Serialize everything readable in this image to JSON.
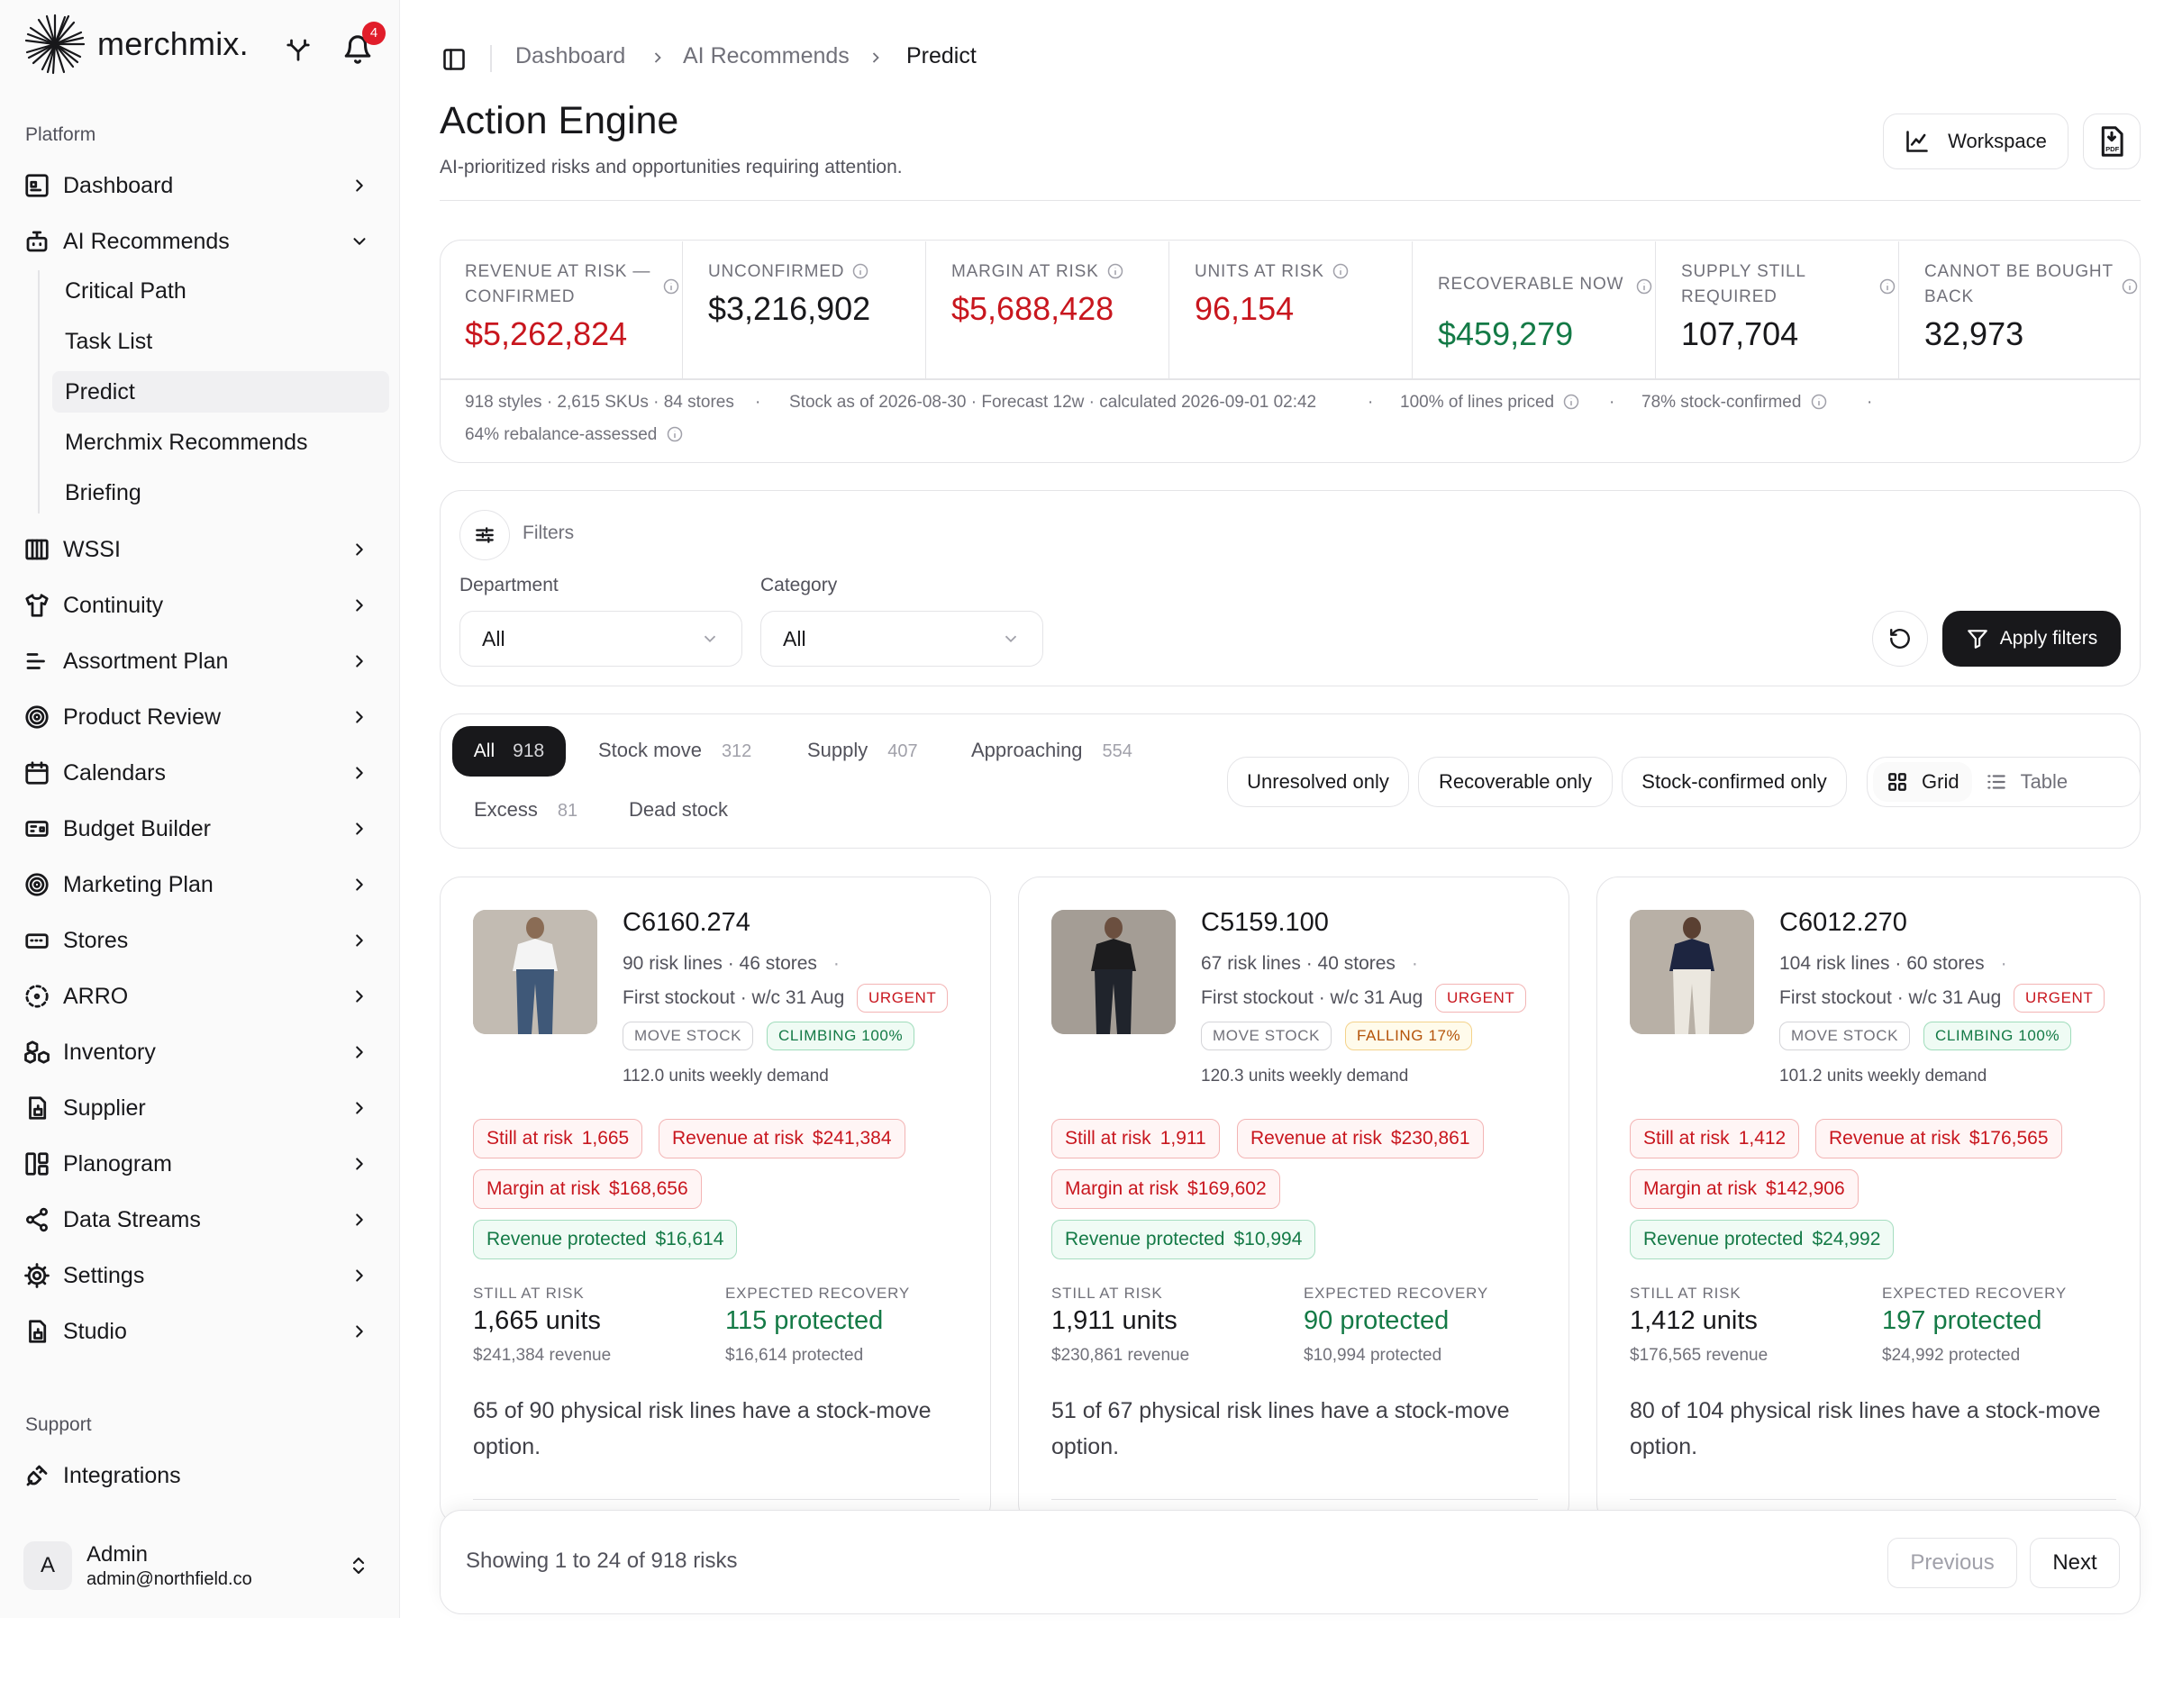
{
  "app": {
    "brand": "merchmix.",
    "notification_count": "4"
  },
  "sidebar": {
    "platform_label": "Platform",
    "support_label": "Support",
    "items": [
      {
        "label": "Dashboard",
        "icon": "dashboard-icon"
      },
      {
        "label": "AI Recommends",
        "icon": "ai-recommends-icon"
      },
      {
        "label": "WSSI",
        "icon": "wssi-icon"
      },
      {
        "label": "Continuity",
        "icon": "shirt-icon"
      },
      {
        "label": "Assortment Plan",
        "icon": "assortment-icon"
      },
      {
        "label": "Product Review",
        "icon": "target-icon"
      },
      {
        "label": "Calendars",
        "icon": "calendar-icon"
      },
      {
        "label": "Budget Builder",
        "icon": "budget-icon"
      },
      {
        "label": "Marketing Plan",
        "icon": "target-icon"
      },
      {
        "label": "Stores",
        "icon": "stores-icon"
      },
      {
        "label": "ARRO",
        "icon": "arro-icon"
      },
      {
        "label": "Inventory",
        "icon": "inventory-icon"
      },
      {
        "label": "Supplier",
        "icon": "supplier-icon"
      },
      {
        "label": "Planogram",
        "icon": "planogram-icon"
      },
      {
        "label": "Data Streams",
        "icon": "share-icon"
      },
      {
        "label": "Settings",
        "icon": "gear-icon"
      },
      {
        "label": "Studio",
        "icon": "studio-icon"
      }
    ],
    "sub_items": [
      "Critical Path",
      "Task List",
      "Predict",
      "Merchmix Recommends",
      "Briefing"
    ],
    "active_sub": "Predict",
    "support_items": [
      {
        "label": "Integrations",
        "icon": "plug-icon"
      }
    ],
    "user": {
      "initial": "A",
      "name": "Admin",
      "email": "admin@northfield.co"
    }
  },
  "breadcrumb": [
    "Dashboard",
    "AI Recommends",
    "Predict"
  ],
  "header": {
    "title": "Action Engine",
    "subtitle": "AI-prioritized risks and opportunities requiring attention.",
    "workspace_label": "Workspace"
  },
  "kpis": [
    {
      "label": "REVENUE AT RISK — CONFIRMED",
      "value": "$5,262,824",
      "tone": "red"
    },
    {
      "label": "UNCONFIRMED",
      "value": "$3,216,902",
      "tone": "default"
    },
    {
      "label": "MARGIN AT RISK",
      "value": "$5,688,428",
      "tone": "red"
    },
    {
      "label": "UNITS AT RISK",
      "value": "96,154",
      "tone": "red"
    },
    {
      "label": "RECOVERABLE NOW",
      "value": "$459,279",
      "tone": "green"
    },
    {
      "label": "SUPPLY STILL REQUIRED",
      "value": "107,704",
      "tone": "default"
    },
    {
      "label": "CANNOT BE BOUGHT BACK",
      "value": "32,973",
      "tone": "default"
    }
  ],
  "meta": {
    "scope": "918 styles · 2,615 SKUs · 84 stores",
    "stock_as_of": "Stock as of 2026-08-30 · Forecast 12w · calculated 2026-09-01 02:42",
    "priced": "100% of lines priced",
    "confirmed": "78% stock-confirmed",
    "rebalance": "64% rebalance-assessed"
  },
  "filters": {
    "title": "Filters",
    "department_label": "Department",
    "department_value": "All",
    "category_label": "Category",
    "category_value": "All",
    "apply_label": "Apply filters"
  },
  "tabs": [
    {
      "label": "All",
      "count": "918",
      "active": true
    },
    {
      "label": "Stock move",
      "count": "312"
    },
    {
      "label": "Supply",
      "count": "407"
    },
    {
      "label": "Approaching",
      "count": "554"
    },
    {
      "label": "Excess",
      "count": "81"
    },
    {
      "label": "Dead stock",
      "count": ""
    }
  ],
  "toggles": [
    "Unresolved only",
    "Recoverable only",
    "Stock-confirmed only"
  ],
  "view": {
    "grid": "Grid",
    "table": "Table",
    "active": "Grid"
  },
  "cards": [
    {
      "code": "C6160.274",
      "lines": "90 risk lines · 46 stores",
      "stockout": "First stockout · w/c 31 Aug",
      "urgency": "URGENT",
      "action": "MOVE STOCK",
      "trend": "CLIMBING 100%",
      "trend_tone": "green",
      "demand": "112.0 units weekly demand",
      "still_label": "Still at risk",
      "still_value": "1,665",
      "rev_label": "Revenue at risk",
      "rev_value": "$241,384",
      "margin_label": "Margin at risk",
      "margin_value": "$168,656",
      "prot_label": "Revenue protected",
      "prot_value": "$16,614",
      "s_label": "STILL AT RISK",
      "s_value": "1,665 units",
      "s_sub": "$241,384 revenue",
      "e_label": "EXPECTED RECOVERY",
      "e_value": "115 protected",
      "e_sub": "$16,614 protected",
      "desc": "65 of 90 physical risk lines have a stock-move option.",
      "shirt": "#f4f4f4",
      "pants": "#3f5878"
    },
    {
      "code": "C5159.100",
      "lines": "67 risk lines · 40 stores",
      "stockout": "First stockout · w/c 31 Aug",
      "urgency": "URGENT",
      "action": "MOVE STOCK",
      "trend": "FALLING 17%",
      "trend_tone": "amber",
      "demand": "120.3 units weekly demand",
      "still_label": "Still at risk",
      "still_value": "1,911",
      "rev_label": "Revenue at risk",
      "rev_value": "$230,861",
      "margin_label": "Margin at risk",
      "margin_value": "$169,602",
      "prot_label": "Revenue protected",
      "prot_value": "$10,994",
      "s_label": "STILL AT RISK",
      "s_value": "1,911 units",
      "s_sub": "$230,861 revenue",
      "e_label": "EXPECTED RECOVERY",
      "e_value": "90 protected",
      "e_sub": "$10,994 protected",
      "desc": "51 of 67 physical risk lines have a stock-move option.",
      "shirt": "#1c1c1e",
      "pants": "#20242c"
    },
    {
      "code": "C6012.270",
      "lines": "104 risk lines · 60 stores",
      "stockout": "First stockout · w/c 31 Aug",
      "urgency": "URGENT",
      "action": "MOVE STOCK",
      "trend": "CLIMBING 100%",
      "trend_tone": "green",
      "demand": "101.2 units weekly demand",
      "still_label": "Still at risk",
      "still_value": "1,412",
      "rev_label": "Revenue at risk",
      "rev_value": "$176,565",
      "margin_label": "Margin at risk",
      "margin_value": "$142,906",
      "prot_label": "Revenue protected",
      "prot_value": "$24,992",
      "s_label": "STILL AT RISK",
      "s_value": "1,412 units",
      "s_sub": "$176,565 revenue",
      "e_label": "EXPECTED RECOVERY",
      "e_value": "197 protected",
      "e_sub": "$24,992 protected",
      "desc": "80 of 104 physical risk lines have a stock-move option.",
      "shirt": "#1d2540",
      "pants": "#ebe7df"
    }
  ],
  "pagination": {
    "summary": "Showing 1 to 24 of 918 risks",
    "previous": "Previous",
    "next": "Next"
  },
  "colors": {
    "red": "#c8161e",
    "green": "#147a46",
    "amber": "#b45309",
    "dark": "#18181b"
  }
}
